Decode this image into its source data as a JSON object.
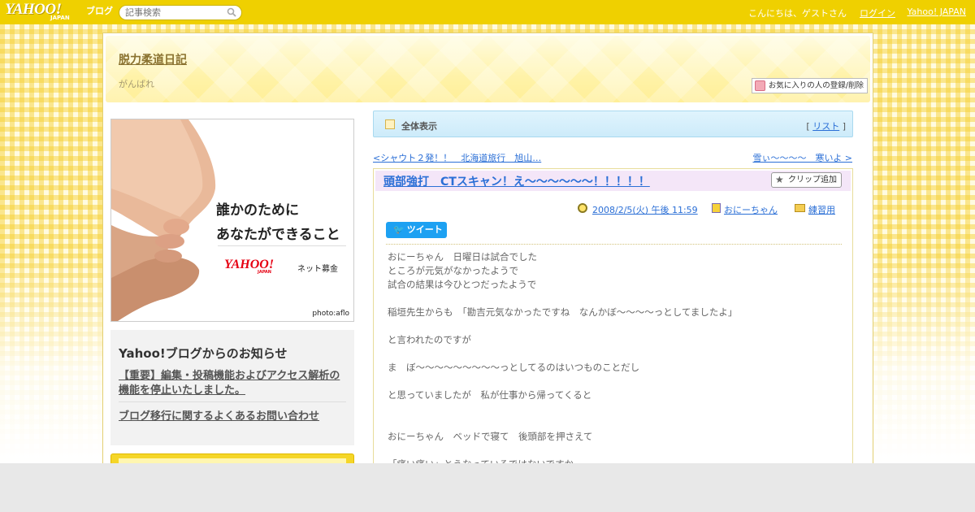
{
  "topbar": {
    "logo_text": "YAHOO!",
    "logo_sub": "JAPAN",
    "logo_blog": "ブログ",
    "search_placeholder": "記事検索",
    "greeting": "こんにちは、ゲストさん",
    "login_label": "ログイン",
    "yahoo_japan_label": "Yahoo! JAPAN"
  },
  "header": {
    "blog_title": "脱力柔道日記",
    "blog_subtitle": "がんばれ",
    "favorite_button_label": "お気に入りの人の登録/削除"
  },
  "ad": {
    "line1": "誰かのために",
    "line2": "あなたができること",
    "logo": "YAHOO!",
    "logo_sub": "JAPAN",
    "tag": "ネット募金",
    "credit": "photo:aflo"
  },
  "notice": {
    "title": "Yahoo!ブログからのお知らせ",
    "link1": "【重要】編集・投稿機能およびアクセス解析の機能を停止いたしました。",
    "link2": "ブログ移行に関するよくあるお問い合わせ"
  },
  "viewbar": {
    "label": "全体表示",
    "list_open": "[ ",
    "list_label": "リスト",
    "list_close": " ]"
  },
  "nav": {
    "prev": "<シャウト２発！！　北海道旅行　旭山…",
    "next": "雪ぃ～～～～　寒いよ >"
  },
  "article": {
    "title": "頭部強打　CTスキャン！え～～～～～～！！！！！",
    "clip_label": "クリップ追加",
    "date": "2008/2/5(火) 午後 11:59",
    "author": "おにーちゃん",
    "category": "練習用",
    "tweet_label": "ツイート",
    "body": [
      "おにーちゃん　日曜日は試合でした",
      "ところが元気がなかったようで",
      "試合の結果は今ひとつだったようで",
      "",
      "稲垣先生からも　「勘吉元気なかったですね　なんかぼ～～～～っとしてましたよ」",
      "",
      "と言われたのですが",
      "",
      "ま　ぼ～～～～～～～～～っとしてるのはいつものことだし",
      "",
      "と思っていましたが　私が仕事から帰ってくると",
      "",
      "",
      "おにーちゃん　ベッドで寝て　後頭部を押さえて",
      "",
      "「痛い痛い」とうなっているではないですか"
    ]
  }
}
